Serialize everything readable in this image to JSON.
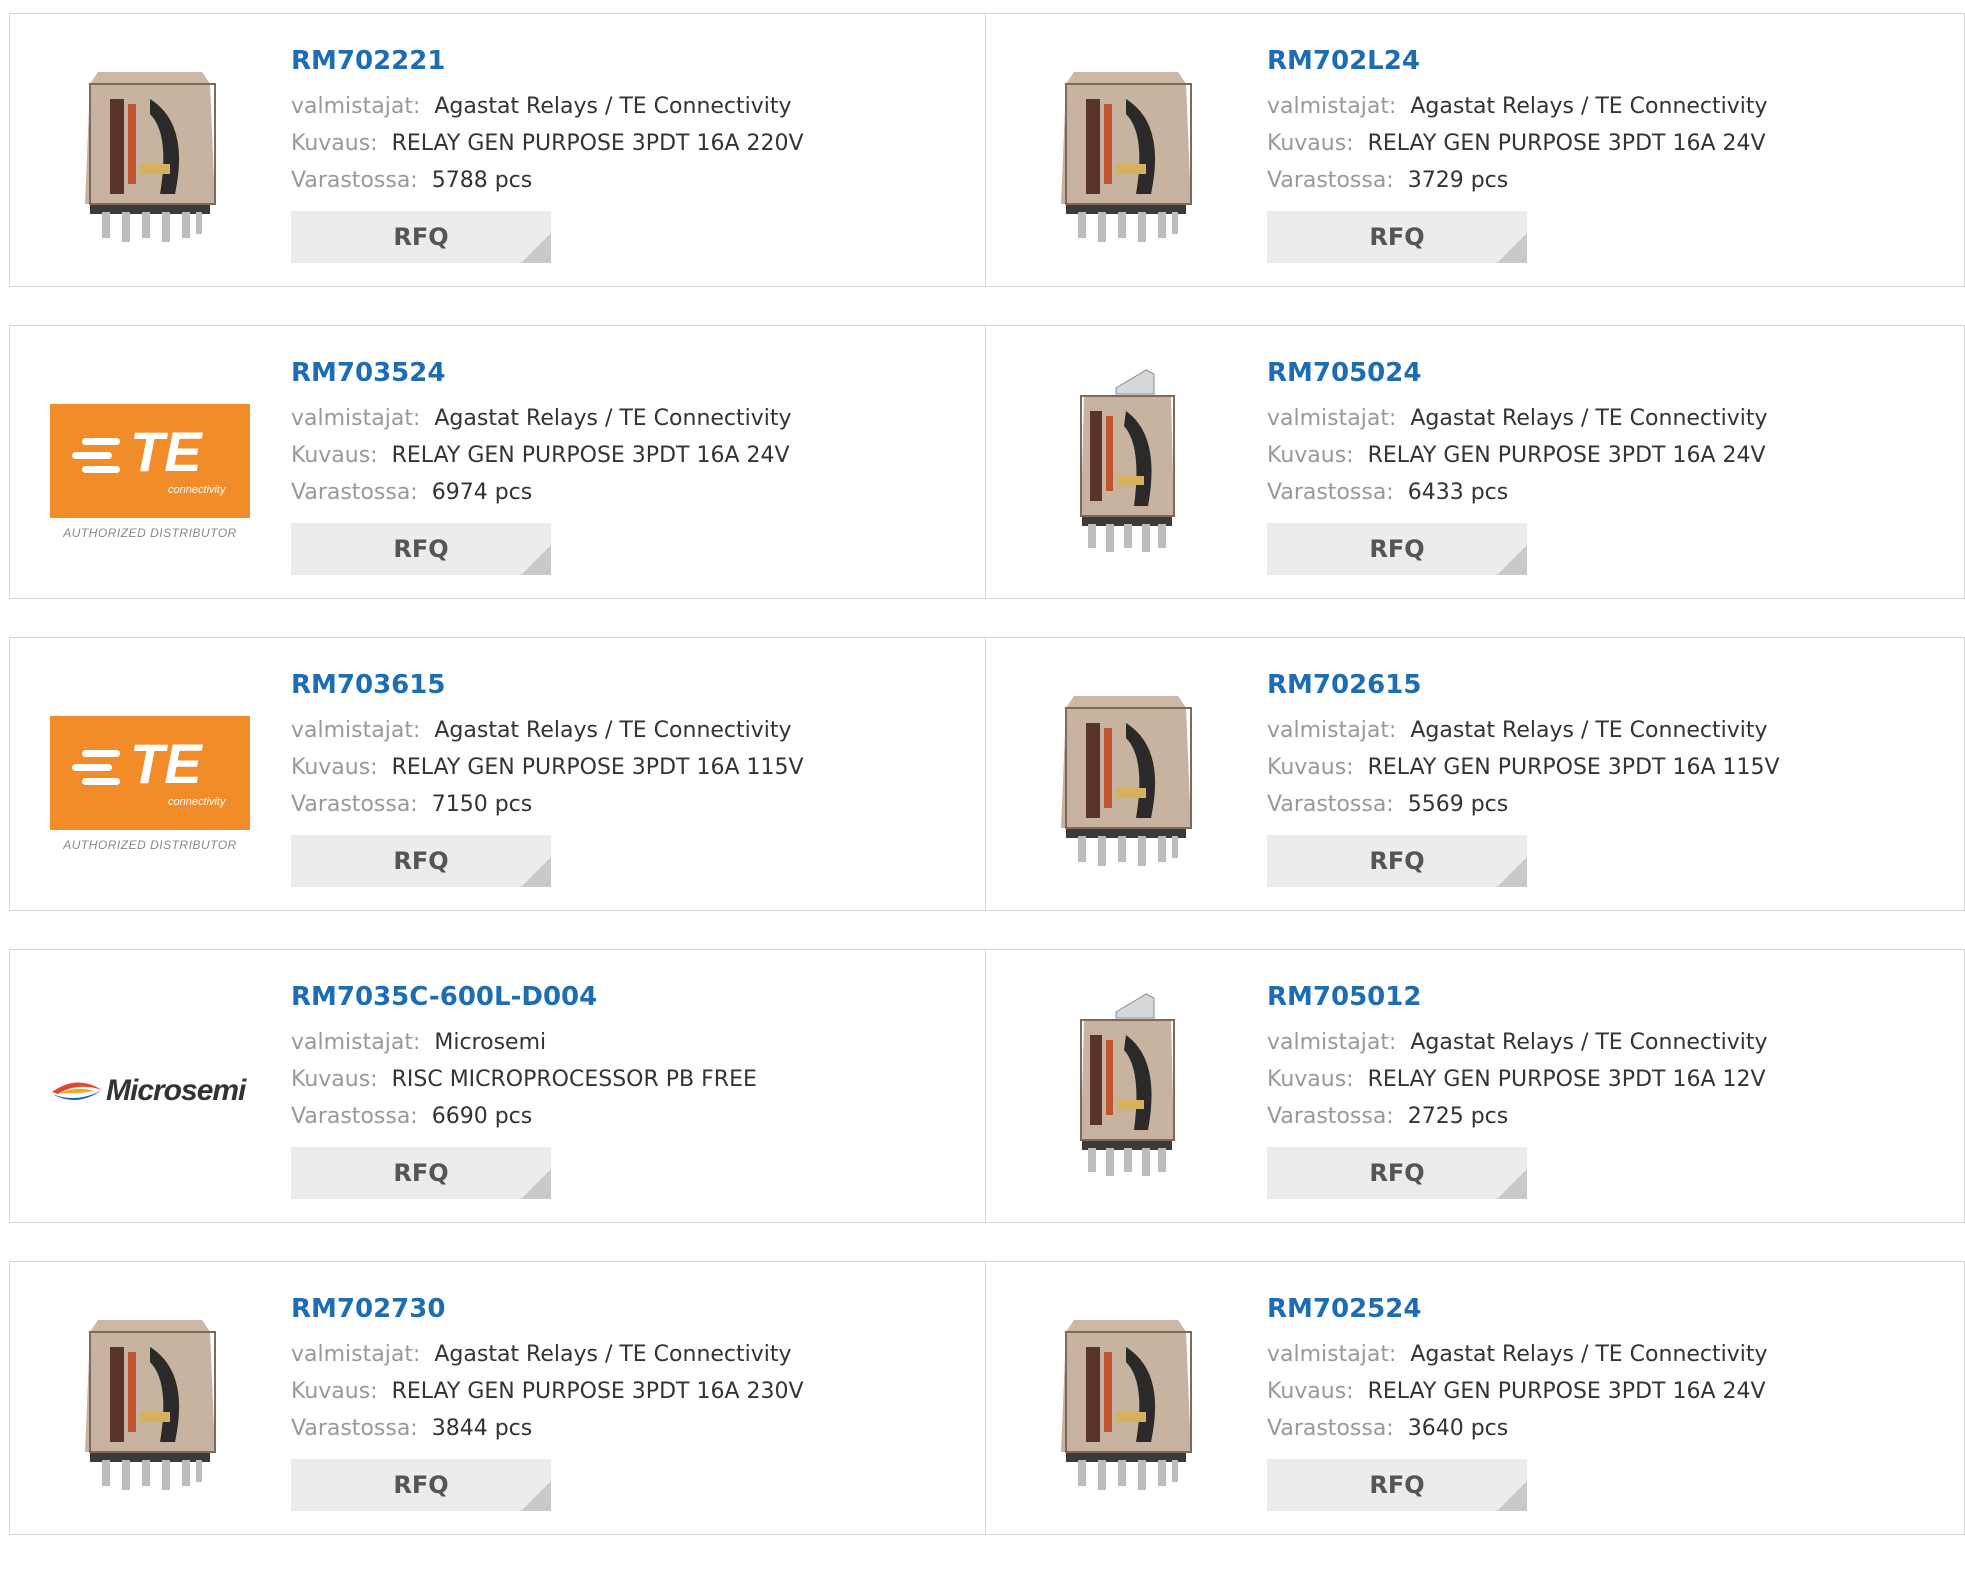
{
  "labels": {
    "manufacturer": "valmistajat:",
    "description": "Kuvaus:",
    "stock": "Varastossa:",
    "rfq": "RFQ"
  },
  "te_logo": {
    "brand": "TE",
    "tagline": "connectivity",
    "badge": "AUTHORIZED DISTRIBUTOR"
  },
  "microsemi_logo": {
    "text": "Microsemi"
  },
  "colors": {
    "link": "#1d6db5",
    "te_orange": "#f28c28",
    "button": "#ececec"
  },
  "products": [
    {
      "part": "RM702221",
      "manufacturer": "Agastat Relays / TE Connectivity",
      "description": "RELAY GEN PURPOSE 3PDT 16A 220V",
      "stock": "5788 pcs",
      "image": "relay-icon"
    },
    {
      "part": "RM702L24",
      "manufacturer": "Agastat Relays / TE Connectivity",
      "description": "RELAY GEN PURPOSE 3PDT 16A 24V",
      "stock": "3729 pcs",
      "image": "relay-icon"
    },
    {
      "part": "RM703524",
      "manufacturer": "Agastat Relays / TE Connectivity",
      "description": "RELAY GEN PURPOSE 3PDT 16A 24V",
      "stock": "6974 pcs",
      "image": "te-logo"
    },
    {
      "part": "RM705024",
      "manufacturer": "Agastat Relays / TE Connectivity",
      "description": "RELAY GEN PURPOSE 3PDT 16A 24V",
      "stock": "6433 pcs",
      "image": "relay-flange-icon"
    },
    {
      "part": "RM703615",
      "manufacturer": "Agastat Relays / TE Connectivity",
      "description": "RELAY GEN PURPOSE 3PDT 16A 115V",
      "stock": "7150 pcs",
      "image": "te-logo"
    },
    {
      "part": "RM702615",
      "manufacturer": "Agastat Relays / TE Connectivity",
      "description": "RELAY GEN PURPOSE 3PDT 16A 115V",
      "stock": "5569 pcs",
      "image": "relay-icon"
    },
    {
      "part": "RM7035C-600L-D004",
      "manufacturer": "Microsemi",
      "description": "RISC MICROPROCESSOR PB FREE",
      "stock": "6690 pcs",
      "image": "microsemi-logo"
    },
    {
      "part": "RM705012",
      "manufacturer": "Agastat Relays / TE Connectivity",
      "description": "RELAY GEN PURPOSE 3PDT 16A 12V",
      "stock": "2725 pcs",
      "image": "relay-flange-icon"
    },
    {
      "part": "RM702730",
      "manufacturer": "Agastat Relays / TE Connectivity",
      "description": "RELAY GEN PURPOSE 3PDT 16A 230V",
      "stock": "3844 pcs",
      "image": "relay-icon"
    },
    {
      "part": "RM702524",
      "manufacturer": "Agastat Relays / TE Connectivity",
      "description": "RELAY GEN PURPOSE 3PDT 16A 24V",
      "stock": "3640 pcs",
      "image": "relay-icon"
    }
  ]
}
